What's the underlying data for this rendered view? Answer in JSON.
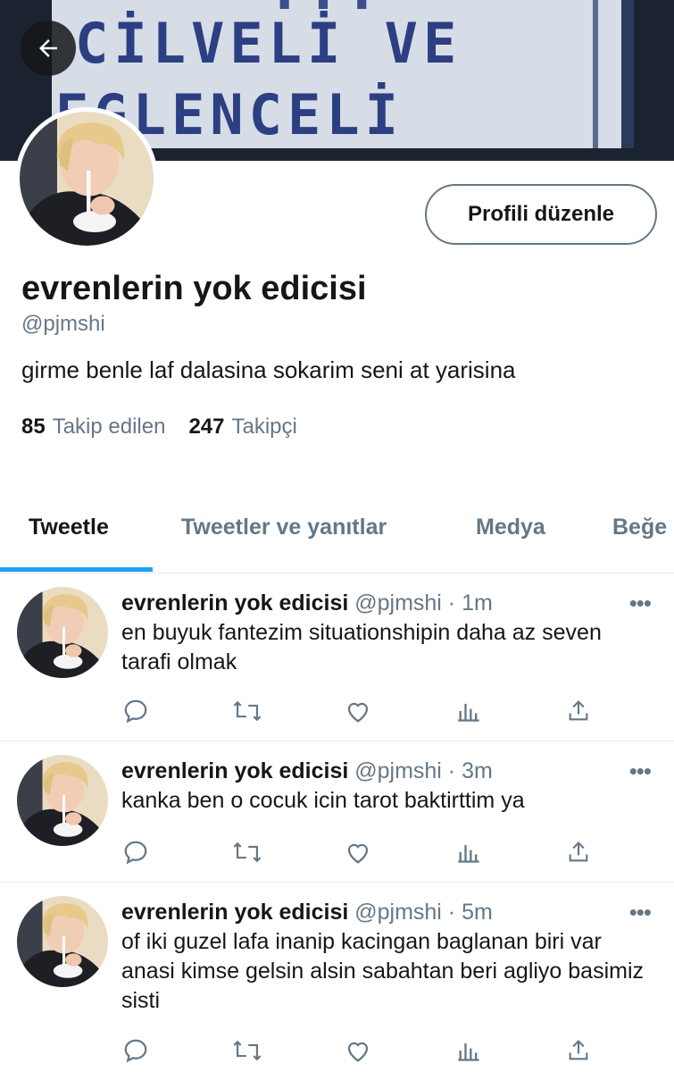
{
  "banner": {
    "line0": "...",
    "line1": "CİLVELİ VE",
    "line2": "EGLENCELİ"
  },
  "profile": {
    "display_name": "evrenlerin yok edicisi",
    "handle": "@pjmshi",
    "bio": "girme benle laf dalasina sokarim seni at yarisina",
    "edit_button": "Profili düzenle",
    "following_count": "85",
    "following_label": "Takip edilen",
    "followers_count": "247",
    "followers_label": "Takipçi"
  },
  "tabs": [
    {
      "label": "Tweetle"
    },
    {
      "label": "Tweetler ve yanıtlar"
    },
    {
      "label": "Medya"
    },
    {
      "label": "Beğe"
    }
  ],
  "tweets": [
    {
      "name": "evrenlerin yok edicisi",
      "meta": " @pjmshi · 1m",
      "text": "en buyuk fantezim situationshipin daha az seven tarafi olmak"
    },
    {
      "name": "evrenlerin yok edicisi",
      "meta": " @pjmshi · 3m",
      "text": "kanka ben o cocuk icin tarot baktirttim ya"
    },
    {
      "name": "evrenlerin yok edicisi",
      "meta": " @pjmshi · 5m",
      "text": "of iki guzel lafa inanip kacingan baglanan biri var anasi kimse gelsin alsin sabahtan beri agliyo basimiz sisti"
    }
  ],
  "more_glyph": "•••",
  "colors": {
    "accent": "#1da1f2",
    "text_primary": "#14171a",
    "text_secondary": "#657786",
    "divider": "#e6ecf0"
  },
  "icons": [
    "back-arrow-icon",
    "reply-icon",
    "retweet-icon",
    "like-icon",
    "analytics-icon",
    "share-icon",
    "more-icon"
  ]
}
